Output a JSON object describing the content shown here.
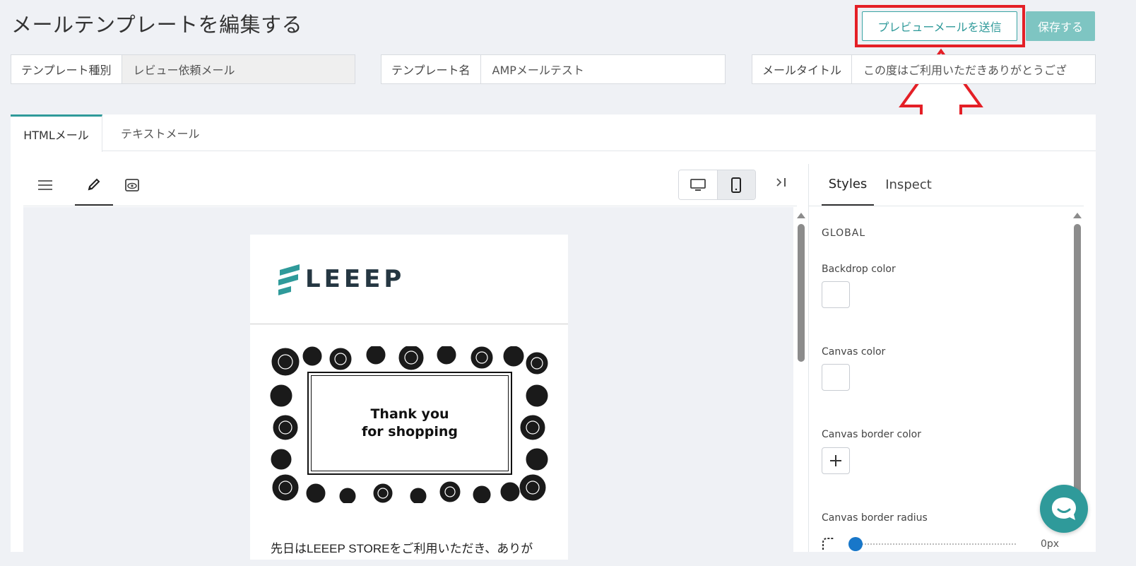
{
  "page": {
    "title": "メールテンプレートを編集する"
  },
  "actions": {
    "preview_label": "プレビューメールを送信",
    "save_label": "保存する"
  },
  "fields": {
    "template_type": {
      "label": "テンプレート種別",
      "value": "レビュー依頼メール"
    },
    "template_name": {
      "label": "テンプレート名",
      "value": "AMPメールテスト"
    },
    "mail_title": {
      "label": "メールタイトル",
      "value": "この度はご利用いただきありがとうござ"
    }
  },
  "tabs": {
    "html": "HTMLメール",
    "text": "テキストメール"
  },
  "email": {
    "logo": "LEEEP",
    "hero_line1": "Thank you",
    "hero_line2": "for shopping",
    "body_text": "先日はLEEEP STOREをご利用いただき、ありが"
  },
  "side_panel": {
    "tab_styles": "Styles",
    "tab_inspect": "Inspect",
    "section": "GLOBAL",
    "backdrop_color": "Backdrop color",
    "canvas_color": "Canvas color",
    "canvas_border_color": "Canvas border color",
    "canvas_border_radius": "Canvas border radius",
    "radius_value": "0px"
  },
  "colors": {
    "accent": "#2f9a9a",
    "save_button": "#7ec5c2",
    "highlight": "#e41f26",
    "logo_dark": "#253742"
  },
  "icons": [
    "hamburger-icon",
    "pencil-icon",
    "eye-icon",
    "desktop-icon",
    "mobile-icon",
    "collapse-right-icon",
    "plus-icon",
    "radius-icon",
    "chat-icon"
  ]
}
